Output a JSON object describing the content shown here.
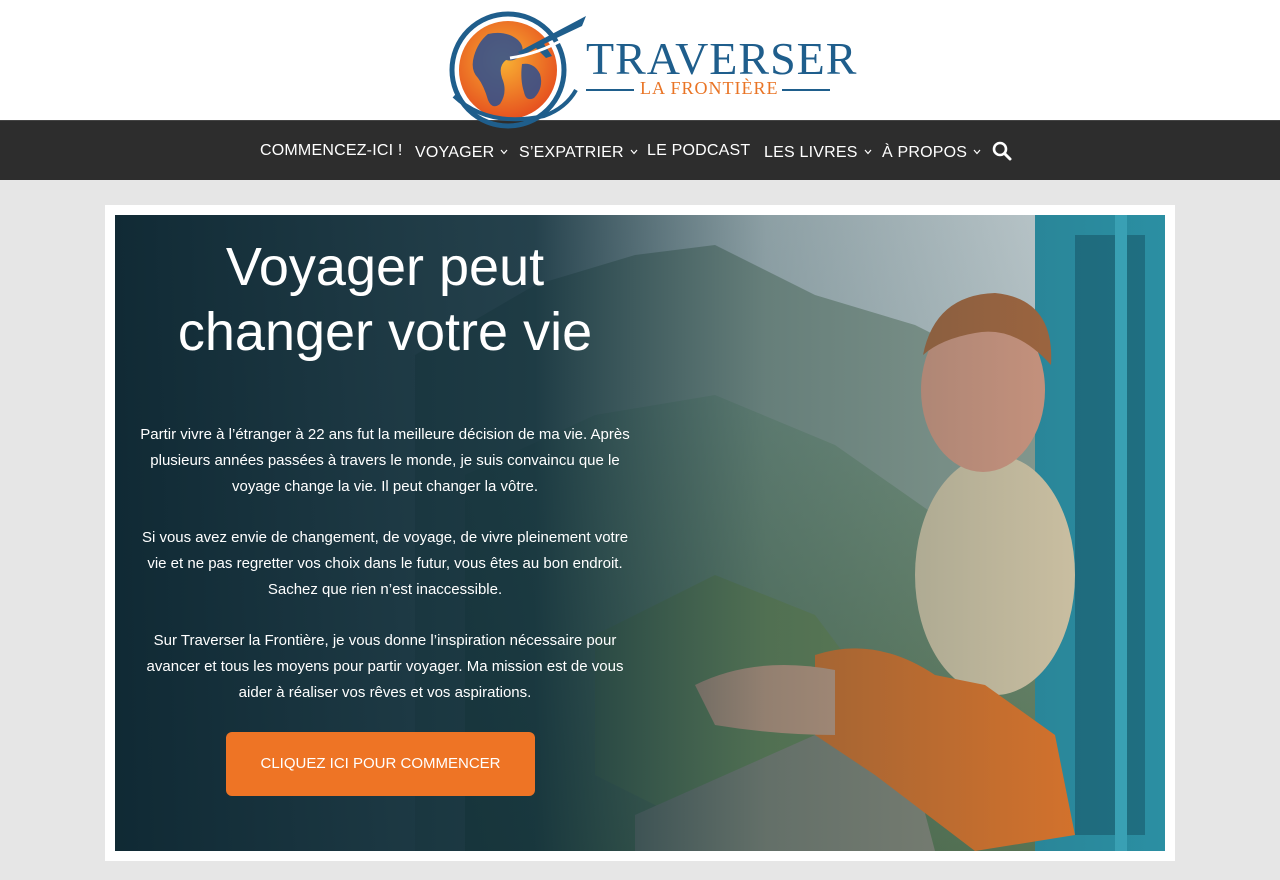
{
  "logo": {
    "title": "TRAVERSER",
    "subtitle": "LA FRONTIÈRE"
  },
  "nav": {
    "items": [
      {
        "label": "COMMENCEZ-ICI !",
        "has_submenu": false
      },
      {
        "label": "VOYAGER",
        "has_submenu": true
      },
      {
        "label": "S’EXPATRIER",
        "has_submenu": true
      },
      {
        "label": "LE PODCAST",
        "has_submenu": false
      },
      {
        "label": "LES LIVRES",
        "has_submenu": true
      },
      {
        "label": "À PROPOS",
        "has_submenu": true
      }
    ],
    "caret_glyph": "⌄",
    "search_icon": "search-icon"
  },
  "hero": {
    "title_line1": "Voyager peut",
    "title_line2": "changer votre vie",
    "paragraphs": [
      "Partir vivre à l’étranger à 22 ans fut la meilleure décision de ma vie. Après plusieurs années passées à travers le monde, je suis convaincu que le voyage change la vie. Il peut changer la vôtre.",
      "Si vous avez envie de changement, de voyage, de vivre pleinement votre vie et ne pas regretter vos choix dans le futur, vous êtes au bon endroit. Sachez que rien n’est inaccessible.",
      "Sur Traverser la Frontière, je vous donne l’inspiration nécessaire pour avancer et tous les moyens pour partir voyager. Ma mission est de vous aider à réaliser vos rêves et vos aspirations."
    ],
    "cta_label": "CLIQUEZ ICI POUR COMMENCER"
  },
  "colors": {
    "nav_bg": "#2d2d2d",
    "accent_orange": "#ee7425",
    "logo_blue": "#1f5e8c",
    "page_bg": "#e6e6e6"
  }
}
